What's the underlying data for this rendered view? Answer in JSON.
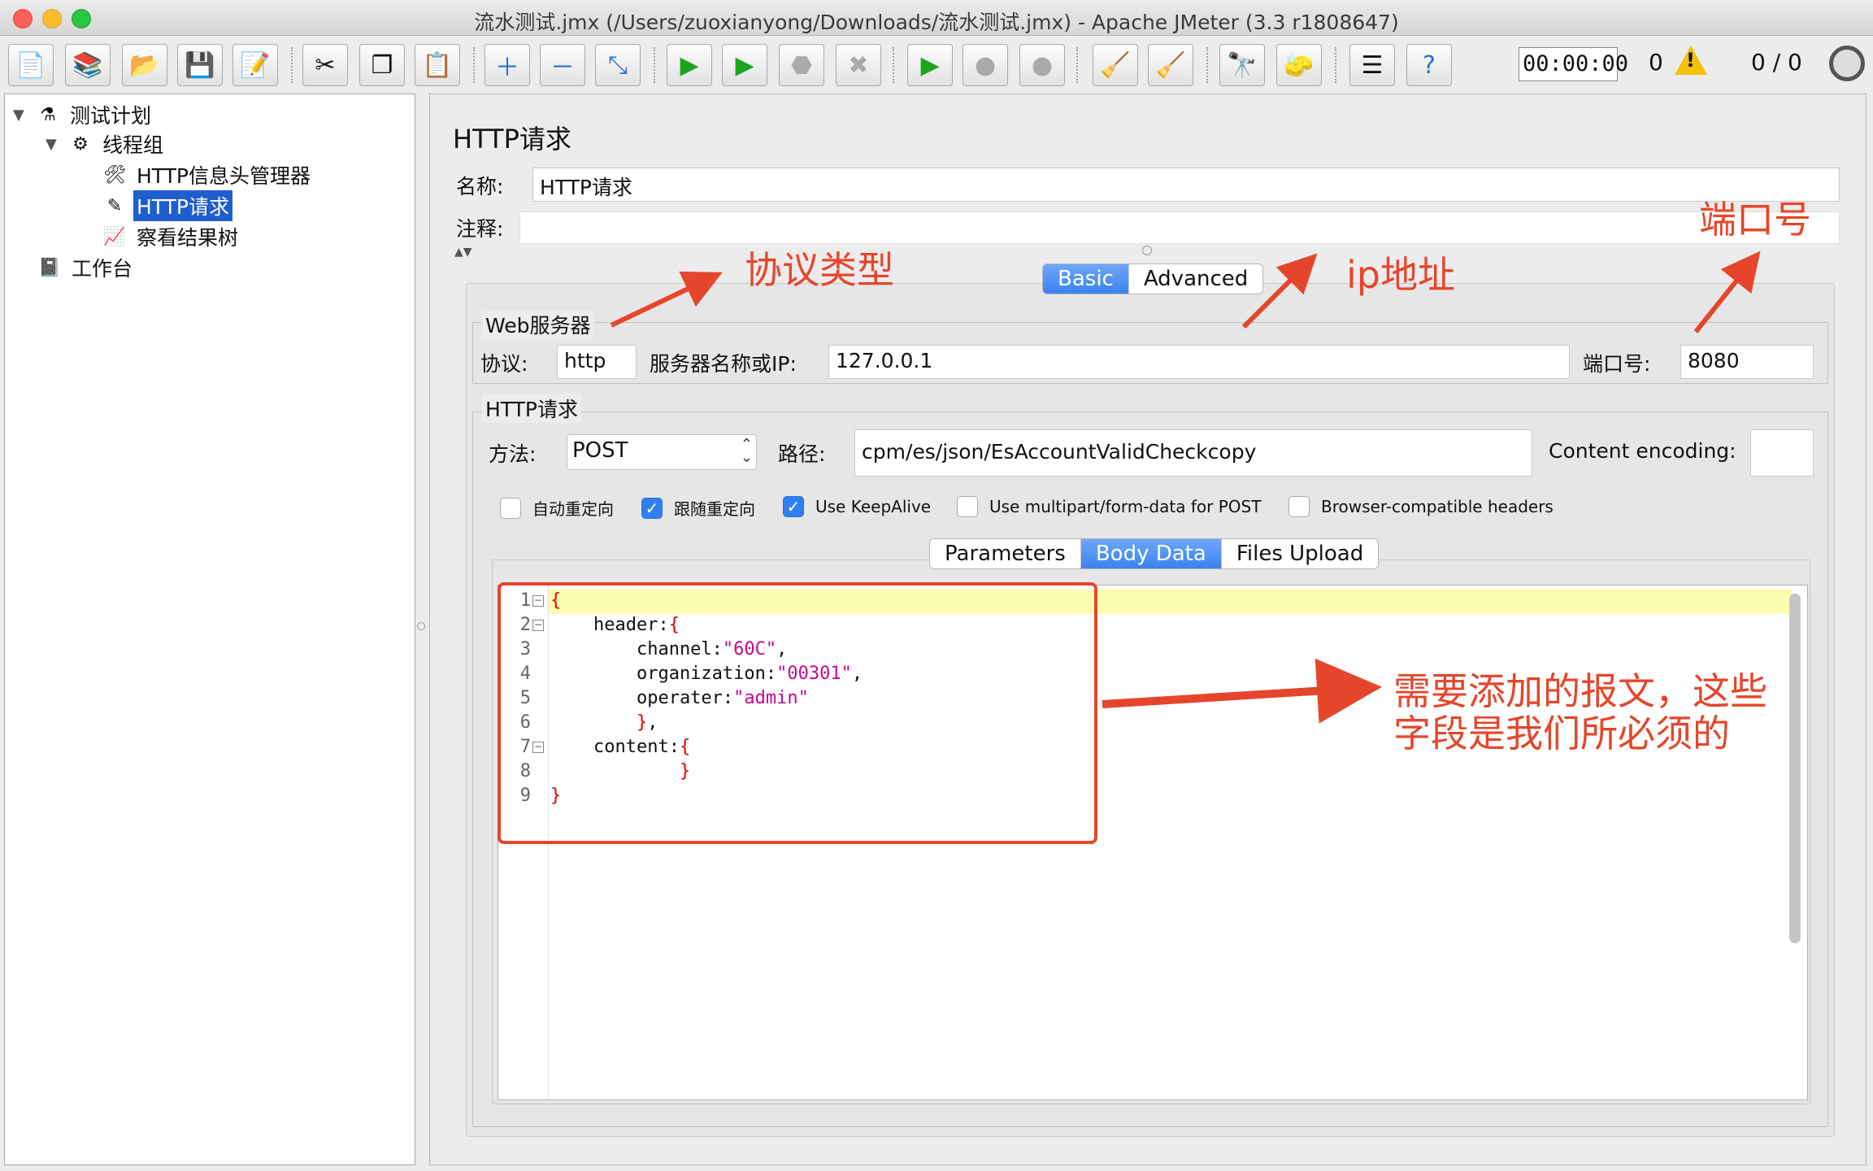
{
  "window": {
    "title": "流水测试.jmx (/Users/zuoxianyong/Downloads/流水测试.jmx) - Apache JMeter (3.3 r1808647)"
  },
  "toolbar": {
    "buttons": [
      "new-icon",
      "templates-icon",
      "open-icon",
      "save-icon",
      "save-as-icon",
      "cut-icon",
      "copy-icon",
      "paste-icon",
      "expand-icon",
      "collapse-icon",
      "toggle-icon",
      "start-icon",
      "start-no-pause-icon",
      "stop-icon",
      "shutdown-icon",
      "remote-start-icon",
      "remote-stop-icon",
      "remote-shutdown-icon",
      "clear-icon",
      "clear-all-icon",
      "search-icon",
      "reset-search-icon",
      "function-helper-icon",
      "help-icon"
    ],
    "timer": "00:00:00",
    "error_count": "0",
    "threads": "0 / 0"
  },
  "tree": {
    "items": [
      {
        "label": "测试计划"
      },
      {
        "label": "线程组"
      },
      {
        "label": "HTTP信息头管理器"
      },
      {
        "label": "HTTP请求"
      },
      {
        "label": "察看结果树"
      },
      {
        "label": "工作台"
      }
    ]
  },
  "panel": {
    "title": "HTTP请求",
    "name_label": "名称:",
    "name_value": "HTTP请求",
    "comment_label": "注释:",
    "comment_value": "",
    "tabs": [
      "Basic",
      "Advanced"
    ],
    "web_server": {
      "legend": "Web服务器",
      "protocol_label": "协议:",
      "protocol_value": "http",
      "server_label": "服务器名称或IP:",
      "server_value": "127.0.0.1",
      "port_label": "端口号:",
      "port_value": "8080"
    },
    "http_request": {
      "legend": "HTTP请求",
      "method_label": "方法:",
      "method_value": "POST",
      "path_label": "路径:",
      "path_value": "cpm/es/json/EsAccountValidCheckcopy",
      "encoding_label": "Content encoding:",
      "encoding_value": ""
    },
    "checkboxes": [
      {
        "label": "自动重定向",
        "checked": false
      },
      {
        "label": "跟随重定向",
        "checked": true
      },
      {
        "label": "Use KeepAlive",
        "checked": true
      },
      {
        "label": "Use multipart/form-data for POST",
        "checked": false
      },
      {
        "label": "Browser-compatible headers",
        "checked": false
      }
    ],
    "body_tabs": [
      "Parameters",
      "Body Data",
      "Files Upload"
    ]
  },
  "editor": {
    "lines": [
      "1",
      "2",
      "3",
      "4",
      "5",
      "6",
      "7",
      "8",
      "9"
    ]
  },
  "annotations": {
    "protocol": "协议类型",
    "ip": "ip地址",
    "port": "端口号",
    "body": "需要添加的报文，这些",
    "body2": "字段是我们所必须的"
  },
  "colors": {
    "accent": "#3b82f0",
    "annotation": "#e5462b",
    "selection": "#1e5ecf"
  }
}
